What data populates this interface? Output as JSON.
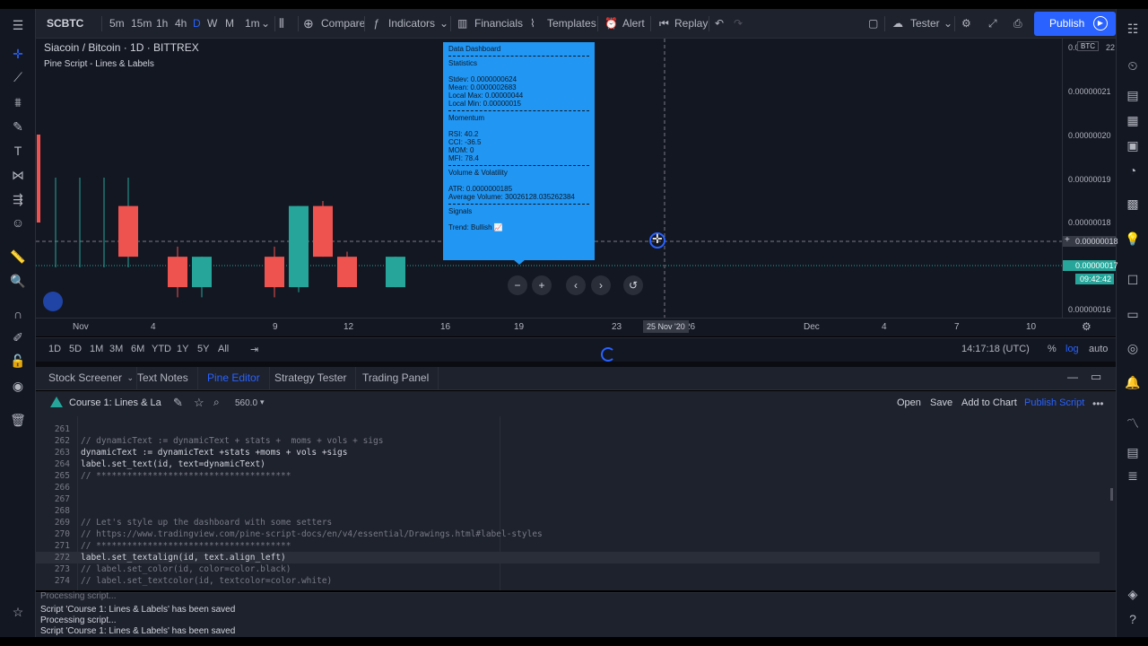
{
  "colors": {
    "up": "#26a69a",
    "down": "#ef5350",
    "accent": "#2962ff",
    "dashboard": "#2196f3",
    "panel": "#1e222d",
    "chart_bg": "#131722"
  },
  "topbar": {
    "symbol": "SCBTC",
    "intervals": [
      "5m",
      "15m",
      "1h",
      "4h",
      "D",
      "W",
      "M",
      "1m"
    ],
    "active_interval": "D",
    "compare": "Compare",
    "indicators": "Indicators",
    "financials": "Financials",
    "templates": "Templates",
    "alert": "Alert",
    "replay": "Replay",
    "tester": "Tester",
    "publish": "Publish"
  },
  "chart": {
    "title": "Siacoin / Bitcoin · 1D · BITTREX",
    "study": "Pine Script - Lines & Labels",
    "price_labels": [
      "0.0",
      "0.00000021",
      "0.00000020",
      "0.00000019",
      "0.00000018",
      "0.00000018",
      "0.00000017",
      "0.00000016"
    ],
    "currency_badge": "BTC",
    "countdown": "09:42:42",
    "current_price": "0.00000017",
    "crosshair_price": "0.00000018",
    "time_labels": [
      "Nov",
      "4",
      "9",
      "12",
      "16",
      "19",
      "23",
      "26",
      "Dec",
      "4",
      "7",
      "10"
    ],
    "crosshair_date": "25 Nov '20",
    "candles": [
      {
        "o": 1.8e-07,
        "h": 1.8e-07,
        "l": 1.7e-07,
        "c": 1.7e-07
      },
      {
        "o": 1.7e-07,
        "h": 1.72e-07,
        "l": 1.62e-07,
        "c": 1.64e-07
      },
      {
        "o": 1.64e-07,
        "h": 1.7e-07,
        "l": 1.62e-07,
        "c": 1.7e-07
      },
      {
        "o": 1.7e-07,
        "h": 1.72e-07,
        "l": 1.62e-07,
        "c": 1.64e-07
      },
      {
        "o": 1.64e-07,
        "h": 1.8e-07,
        "l": 1.63e-07,
        "c": 1.8e-07
      },
      {
        "o": 1.8e-07,
        "h": 1.81e-07,
        "l": 1.7e-07,
        "c": 1.7e-07
      },
      {
        "o": 1.7e-07,
        "h": 1.71e-07,
        "l": 1.64e-07,
        "c": 1.64e-07
      },
      {
        "o": 1.64e-07,
        "h": 1.7e-07,
        "l": 1.64e-07,
        "c": 1.7e-07
      }
    ]
  },
  "dashboard": {
    "lines": [
      "Data Dashboard",
      "---",
      "Statistics",
      "",
      "Stdev: 0.0000000624",
      "Mean: 0.0000002683",
      "Local Max: 0.00000044",
      "Local Min: 0.00000015",
      "---",
      "Momentum",
      "",
      "RSI: 40.2",
      "CCI: -36.5",
      "MOM: 0",
      "MFI: 78.4",
      "---",
      "Volume & Volatility",
      "",
      "ATR: 0.0000000185",
      "Average Volume: 30026128.035262384",
      "---",
      "Signals",
      "",
      "Trend: Bullish 📈"
    ]
  },
  "nav_buttons": [
    "−",
    "+",
    "‹",
    "›",
    "↺"
  ],
  "rangebar": {
    "ranges": [
      "1D",
      "5D",
      "1M",
      "3M",
      "6M",
      "YTD",
      "1Y",
      "5Y",
      "All"
    ],
    "time": "14:17:18 (UTC)",
    "percent": "%",
    "log": "log",
    "auto": "auto"
  },
  "tabs": [
    {
      "label": "Stock Screener",
      "active": false
    },
    {
      "label": "Text Notes",
      "active": false
    },
    {
      "label": "Pine Editor",
      "active": true
    },
    {
      "label": "Strategy Tester",
      "active": false
    },
    {
      "label": "Trading Panel",
      "active": false
    }
  ],
  "editor": {
    "script_name": "Course 1: Lines & La",
    "version": "560.0",
    "open": "Open",
    "save": "Save",
    "add_to_chart": "Add to Chart",
    "publish_script": "Publish Script"
  },
  "code": [
    {
      "n": "261",
      "t": "",
      "k": "code"
    },
    {
      "n": "262",
      "t": "// dynamicText := dynamicText + stats +  moms + vols + sigs",
      "k": "cm"
    },
    {
      "n": "263",
      "t": "dynamicText := dynamicText +stats +moms + vols +sigs",
      "k": "code"
    },
    {
      "n": "264",
      "t": "label.set_text(id, text=dynamicText)",
      "k": "code"
    },
    {
      "n": "265",
      "t": "// **************************************",
      "k": "cm"
    },
    {
      "n": "266",
      "t": "",
      "k": "code"
    },
    {
      "n": "267",
      "t": "",
      "k": "code"
    },
    {
      "n": "268",
      "t": "",
      "k": "code"
    },
    {
      "n": "269",
      "t": "// Let's style up the dashboard with some setters",
      "k": "cm"
    },
    {
      "n": "270",
      "t": "// https://www.tradingview.com/pine-script-docs/en/v4/essential/Drawings.html#label-styles",
      "k": "cm"
    },
    {
      "n": "271",
      "t": "// **************************************",
      "k": "cm"
    },
    {
      "n": "272",
      "t": "label.set_textalign(id, text.align_left)",
      "k": "code",
      "hl": true
    },
    {
      "n": "273",
      "t": "// label.set_color(id, color=color.black)",
      "k": "cm"
    },
    {
      "n": "274",
      "t": "// label.set_textcolor(id, textcolor=color.white)",
      "k": "cm"
    }
  ],
  "console": [
    "Processing script...",
    "Script 'Course 1: Lines & Labels' has been saved",
    "Processing script...",
    "Script 'Course 1: Lines & Labels' has been saved"
  ]
}
